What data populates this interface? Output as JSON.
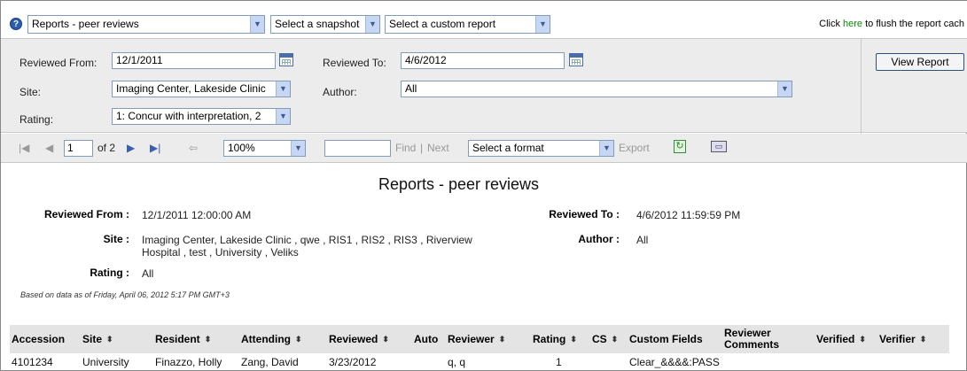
{
  "topbar": {
    "report_select": "Reports - peer reviews",
    "snapshot_select": "Select a snapshot",
    "custom_report_select": "Select a custom report",
    "flush_prefix": "Click ",
    "flush_link": "here",
    "flush_suffix": " to flush the report cach"
  },
  "params": {
    "reviewed_from_label": "Reviewed From:",
    "reviewed_from_value": "12/1/2011",
    "reviewed_to_label": "Reviewed To:",
    "reviewed_to_value": "4/6/2012",
    "site_label": "Site:",
    "site_value": "Imaging Center, Lakeside Clinic",
    "author_label": "Author:",
    "author_value": "All",
    "rating_label": "Rating:",
    "rating_value": "1: Concur with interpretation, 2",
    "view_report_button": "View Report"
  },
  "toolbar": {
    "first_icon": "first-page-icon",
    "prev_icon": "previous-page-icon",
    "page_value": "1",
    "of_pages": "of 2",
    "next_icon": "next-page-icon",
    "last_icon": "last-page-icon",
    "back_icon": "back-to-parent-icon",
    "zoom_value": "100%",
    "find_label": "Find",
    "separator": "|",
    "next_label": "Next",
    "format_select": "Select a format",
    "export_label": "Export",
    "refresh_icon": "refresh-icon",
    "print_icon": "print-icon"
  },
  "report": {
    "title": "Reports - peer reviews",
    "reviewed_from_label": "Reviewed From :",
    "reviewed_from_value": "12/1/2011 12:00:00 AM",
    "reviewed_to_label": "Reviewed To :",
    "reviewed_to_value": "4/6/2012 11:59:59 PM",
    "site_label": "Site :",
    "site_value": "Imaging Center, Lakeside Clinic , qwe , RIS1 , RIS2 , RIS3 , Riverview Hospital , test , University , Veliks",
    "author_label": "Author :",
    "author_value": "All",
    "rating_label": "Rating :",
    "rating_value": "All",
    "based_on": "Based on data as of Friday, April 06, 2012 5:17 PM GMT+3"
  },
  "table": {
    "headers": {
      "accession": "Accession",
      "site": "Site",
      "resident": "Resident",
      "attending": "Attending",
      "reviewed": "Reviewed",
      "auto": "Auto",
      "reviewer": "Reviewer",
      "rating": "Rating",
      "cs": "CS",
      "custom_fields": "Custom Fields",
      "reviewer_comments": "Reviewer Comments",
      "verified": "Verified",
      "verifier": "Verifier"
    },
    "sort_glyph": "⬍",
    "rows": [
      {
        "accession": "4101234",
        "site": "University",
        "resident": "Finazzo, Holly",
        "attending": "Zang, David",
        "reviewed": "3/23/2012",
        "reviewer": "q, q",
        "rating": "1",
        "custom_fields": "Clear_&&&&:PASS"
      }
    ]
  }
}
